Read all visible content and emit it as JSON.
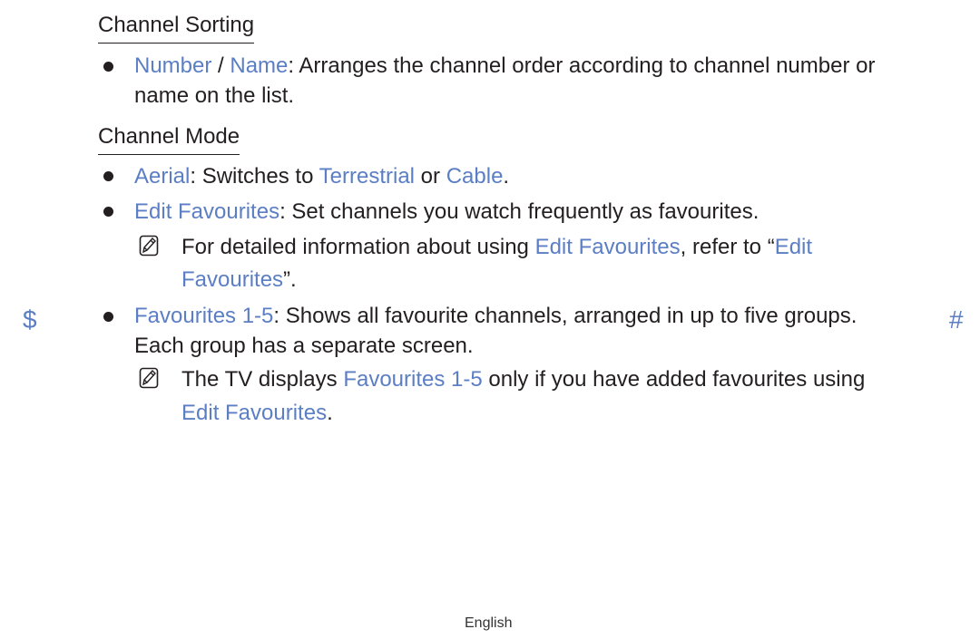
{
  "sections": {
    "sorting": {
      "heading": "Channel Sorting",
      "item1": {
        "k1": "Number",
        "sep": " / ",
        "k2": "Name",
        "t1": ": Arranges the channel order according to channel number or",
        "t2": "name on the list."
      }
    },
    "mode": {
      "heading": "Channel Mode",
      "item1": {
        "k1": "Aerial",
        "t1": ": Switches to ",
        "k2": "Terrestrial",
        "t2": " or ",
        "k3": "Cable",
        "t3": "."
      },
      "item2": {
        "k1": "Edit Favourites",
        "t1": ": Set channels you watch frequently as favourites."
      },
      "note1": {
        "t1": "For detailed information about using ",
        "k1": "Edit Favourites",
        "t2": ", refer to “",
        "k2": "Edit",
        "k3": "Favourites",
        "t3": "”."
      },
      "item3": {
        "k1": "Favourites 1-5",
        "t1": ": Shows all favourite channels, arranged in up to five groups.",
        "t2": "Each group has a separate screen."
      },
      "note2": {
        "t1": "The TV displays ",
        "k1": "Favourites 1-5",
        "t2": " only if you have added favourites using",
        "k2": "Edit Favourites",
        "t3": "."
      }
    }
  },
  "margin": {
    "left_mark": "$",
    "right_mark": "#"
  },
  "footer": {
    "language": "English"
  },
  "icons": {
    "note": "note-pencil-icon",
    "bullet": "bullet-icon"
  },
  "colors": {
    "accent": "#5b7ec4",
    "text": "#231f20"
  }
}
